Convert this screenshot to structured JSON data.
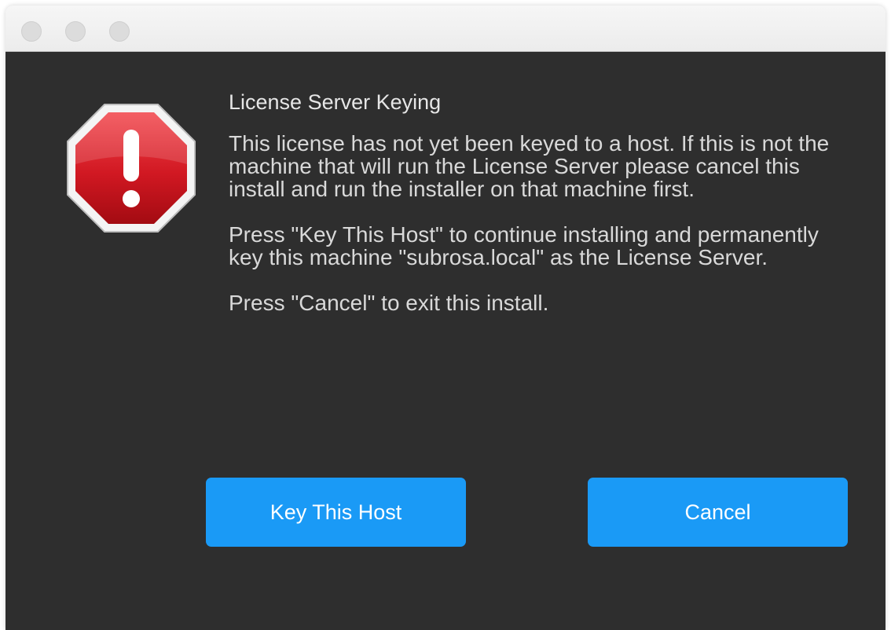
{
  "dialog": {
    "title": "License Server Keying",
    "paragraphs": [
      "This license has not yet been keyed to a host. If this is not the machine that will run the License Server please cancel this install and run the installer on that machine first.",
      "Press \"Key This Host\" to continue installing and permanently key this machine \"subrosa.local\" as the License Server.",
      "Press \"Cancel\" to exit this install."
    ],
    "icon": "stop-warning-icon"
  },
  "buttons": {
    "key_label": "Key This Host",
    "cancel_label": "Cancel"
  },
  "colors": {
    "background": "#2e2e2e",
    "button": "#1a9af6",
    "icon_red": "#d0121b"
  }
}
